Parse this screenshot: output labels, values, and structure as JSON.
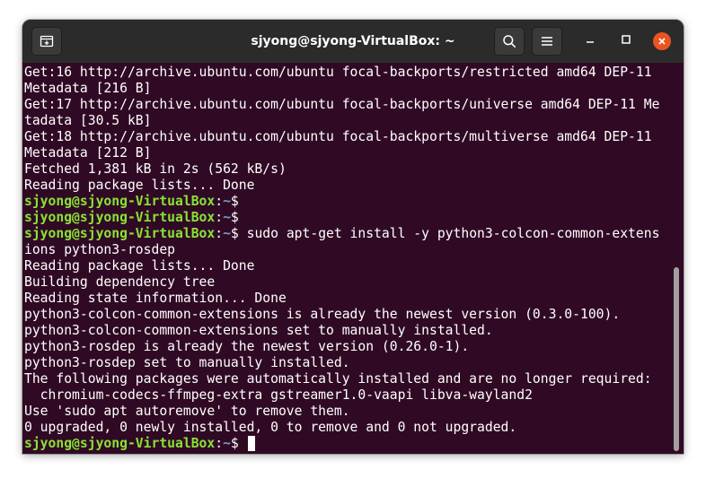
{
  "window": {
    "title": "sjyong@sjyong-VirtualBox: ~"
  },
  "titlebar": {
    "new_tab_icon": "new-tab-icon",
    "search_icon": "search-icon",
    "menu_icon": "hamburger-menu-icon",
    "minimize_icon": "minimize-icon",
    "maximize_icon": "maximize-icon",
    "close_icon": "close-icon"
  },
  "colors": {
    "terminal_bg": "#300a24",
    "text": "#ffffff",
    "prompt_user": "#8ae234",
    "prompt_path": "#729fcf",
    "close_button": "#e95420",
    "titlebar_bg": "#2b2b2b"
  },
  "prompt": {
    "user_host": "sjyong@sjyong-VirtualBox",
    "colon": ":",
    "path": "~",
    "symbol": "$"
  },
  "terminal": {
    "lines": [
      {
        "kind": "text",
        "text": "Get:16 http://archive.ubuntu.com/ubuntu focal-backports/restricted amd64 DEP-11"
      },
      {
        "kind": "text",
        "text": "Metadata [216 B]"
      },
      {
        "kind": "text",
        "text": "Get:17 http://archive.ubuntu.com/ubuntu focal-backports/universe amd64 DEP-11 Me"
      },
      {
        "kind": "text",
        "text": "tadata [30.5 kB]"
      },
      {
        "kind": "text",
        "text": "Get:18 http://archive.ubuntu.com/ubuntu focal-backports/multiverse amd64 DEP-11"
      },
      {
        "kind": "text",
        "text": "Metadata [212 B]"
      },
      {
        "kind": "text",
        "text": "Fetched 1,381 kB in 2s (562 kB/s)"
      },
      {
        "kind": "text",
        "text": "Reading package lists... Done"
      },
      {
        "kind": "prompt",
        "command": ""
      },
      {
        "kind": "prompt",
        "command": ""
      },
      {
        "kind": "prompt",
        "command": " sudo apt-get install -y python3-colcon-common-extens"
      },
      {
        "kind": "text",
        "text": "ions python3-rosdep"
      },
      {
        "kind": "text",
        "text": "Reading package lists... Done"
      },
      {
        "kind": "text",
        "text": "Building dependency tree"
      },
      {
        "kind": "text",
        "text": "Reading state information... Done"
      },
      {
        "kind": "text",
        "text": "python3-colcon-common-extensions is already the newest version (0.3.0-100)."
      },
      {
        "kind": "text",
        "text": "python3-colcon-common-extensions set to manually installed."
      },
      {
        "kind": "text",
        "text": "python3-rosdep is already the newest version (0.26.0-1)."
      },
      {
        "kind": "text",
        "text": "python3-rosdep set to manually installed."
      },
      {
        "kind": "text",
        "text": "The following packages were automatically installed and are no longer required:"
      },
      {
        "kind": "text",
        "text": "  chromium-codecs-ffmpeg-extra gstreamer1.0-vaapi libva-wayland2"
      },
      {
        "kind": "text",
        "text": "Use 'sudo apt autoremove' to remove them."
      },
      {
        "kind": "text",
        "text": "0 upgraded, 0 newly installed, 0 to remove and 0 not upgraded."
      },
      {
        "kind": "prompt",
        "command": " ",
        "cursor": true
      }
    ]
  }
}
